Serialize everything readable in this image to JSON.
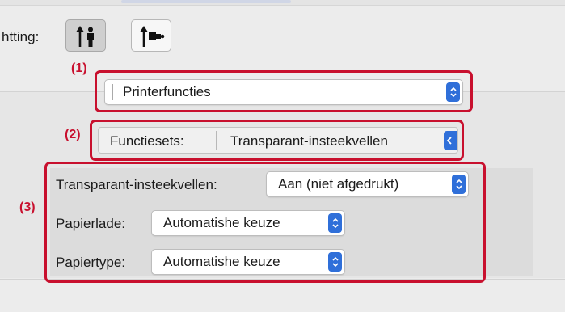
{
  "orientation": {
    "label": "htting:",
    "options": [
      {
        "name": "portrait",
        "selected": true
      },
      {
        "name": "landscape",
        "selected": false
      }
    ]
  },
  "callouts": {
    "one": "(1)",
    "two": "(2)",
    "three": "(3)"
  },
  "panel_select": {
    "value": "Printerfuncties"
  },
  "feature_sets": {
    "label": "Functiesets:",
    "value": "Transparant-insteekvellen"
  },
  "settings": [
    {
      "label": "Transparant-insteekvellen:",
      "value": "Aan (niet afgedrukt)"
    },
    {
      "label": "Papierlade:",
      "value": "Automatishe keuze"
    },
    {
      "label": "Papiertype:",
      "value": "Automatishe keuze"
    }
  ],
  "colors": {
    "accent": "#2f6fd9",
    "highlight": "#c8102e"
  }
}
